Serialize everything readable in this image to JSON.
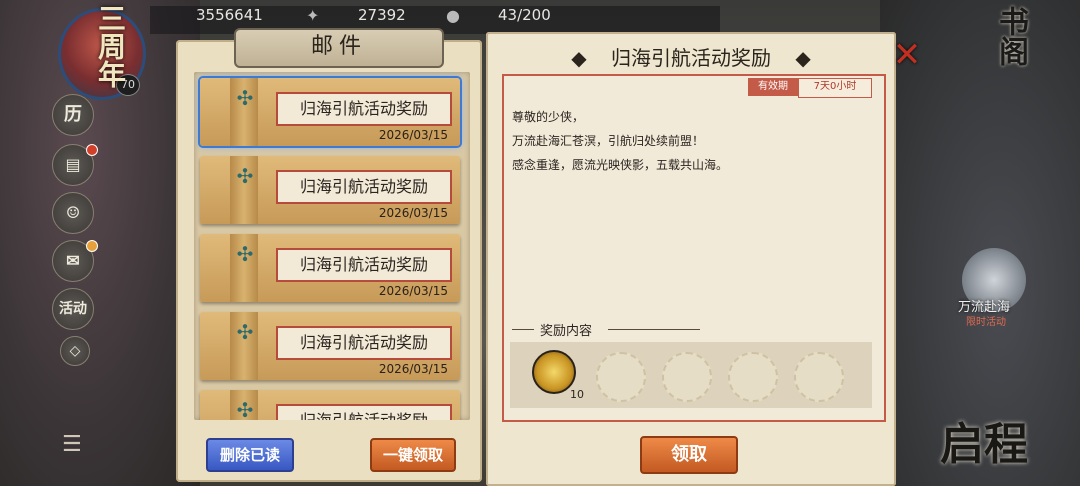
{
  "resources": {
    "coins": "3556641",
    "jade": "27392",
    "stamina": "43/200"
  },
  "profile": {
    "level": "70",
    "anniversary_text": "三周年"
  },
  "sidebar": {
    "history": "历",
    "activity": "活动"
  },
  "shop_label": "书阁",
  "event": {
    "title": "万流赴海",
    "subtitle": "限时活动"
  },
  "journey_label": "启程",
  "mailbox": {
    "title": "邮件",
    "items": [
      {
        "label": "归海引航活动奖励",
        "date": "2026/03/15",
        "selected": true
      },
      {
        "label": "归海引航活动奖励",
        "date": "2026/03/15",
        "selected": false
      },
      {
        "label": "归海引航活动奖励",
        "date": "2026/03/15",
        "selected": false
      },
      {
        "label": "归海引航活动奖励",
        "date": "2026/03/15",
        "selected": false
      },
      {
        "label": "归海引航活动奖励",
        "date": "",
        "selected": false
      }
    ],
    "delete_read_label": "删除已读",
    "claim_all_label": "一键领取"
  },
  "detail": {
    "title": "归海引航活动奖励",
    "validity_label": "有效期",
    "validity_value": "7天0小时",
    "body_lines": [
      "尊敬的少侠，",
      "万流赴海汇苍溟，引航归处续前盟！",
      "感念重逢，愿流光映侠影，五载共山海。"
    ],
    "reward_heading": "奖励内容",
    "reward_count": "10",
    "claim_label": "领取"
  },
  "colors": {
    "accent_red": "#c45b48",
    "selected_border": "#3c7ad6",
    "claim_orange": "#ee8a48",
    "delete_blue": "#3858c2"
  }
}
